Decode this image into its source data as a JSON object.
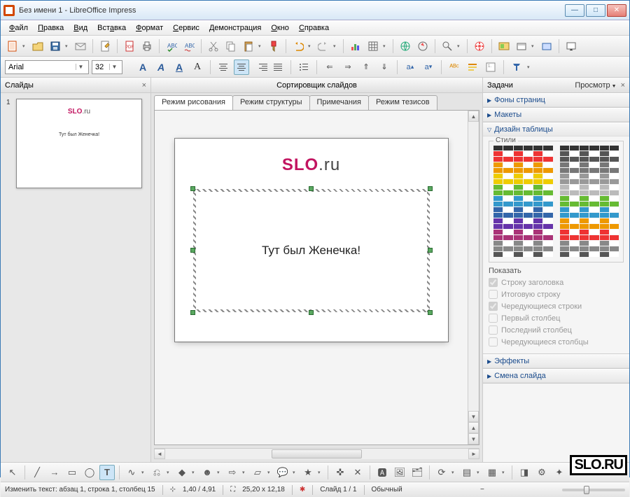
{
  "window": {
    "title": "Без имени 1 - LibreOffice Impress"
  },
  "menu": [
    {
      "label": "Файл",
      "u": 0
    },
    {
      "label": "Правка",
      "u": 0
    },
    {
      "label": "Вид",
      "u": 0
    },
    {
      "label": "Вставка",
      "u": 3
    },
    {
      "label": "Формат",
      "u": 0
    },
    {
      "label": "Сервис",
      "u": 0
    },
    {
      "label": "Демонстрация",
      "u": 0
    },
    {
      "label": "Окно",
      "u": 0
    },
    {
      "label": "Справка",
      "u": 0
    }
  ],
  "format": {
    "font": "Arial",
    "size": "32"
  },
  "slides_panel": {
    "title": "Слайды"
  },
  "slide_thumb": {
    "num": "1",
    "title_main": "SLO",
    "title_suffix": ".ru",
    "body": "Тут был Женечка!"
  },
  "center": {
    "header": "Сортировщик слайдов"
  },
  "tabs": [
    {
      "label": "Режим рисования",
      "active": true
    },
    {
      "label": "Режим структуры",
      "active": false
    },
    {
      "label": "Примечания",
      "active": false
    },
    {
      "label": "Режим тезисов",
      "active": false
    }
  ],
  "slide": {
    "title_main": "SLO",
    "title_suffix": ".ru",
    "body": "Тут был Женечка!"
  },
  "tasks": {
    "title": "Задачи",
    "view": "Просмотр",
    "sections": {
      "pages": "Фоны страниц",
      "layouts": "Макеты",
      "table_design": "Дизайн таблицы",
      "effects": "Эффекты",
      "transition": "Смена слайда"
    },
    "styles_label": "Стили",
    "show_label": "Показать",
    "checks": [
      {
        "label": "Строку заголовка",
        "checked": true
      },
      {
        "label": "Итоговую строку",
        "checked": false
      },
      {
        "label": "Чередующиеся строки",
        "checked": true
      },
      {
        "label": "Первый столбец",
        "checked": false
      },
      {
        "label": "Последний столбец",
        "checked": false
      },
      {
        "label": "Чередующиеся столбцы",
        "checked": false
      }
    ]
  },
  "status": {
    "edit": "Изменить текст: абзац 1, строка 1, столбец 15",
    "pos": "1,40 / 4,91",
    "size": "25,20 x 12,18",
    "slide": "Слайд 1 / 1",
    "layout": "Обычный"
  },
  "watermark": "SLO.RU"
}
